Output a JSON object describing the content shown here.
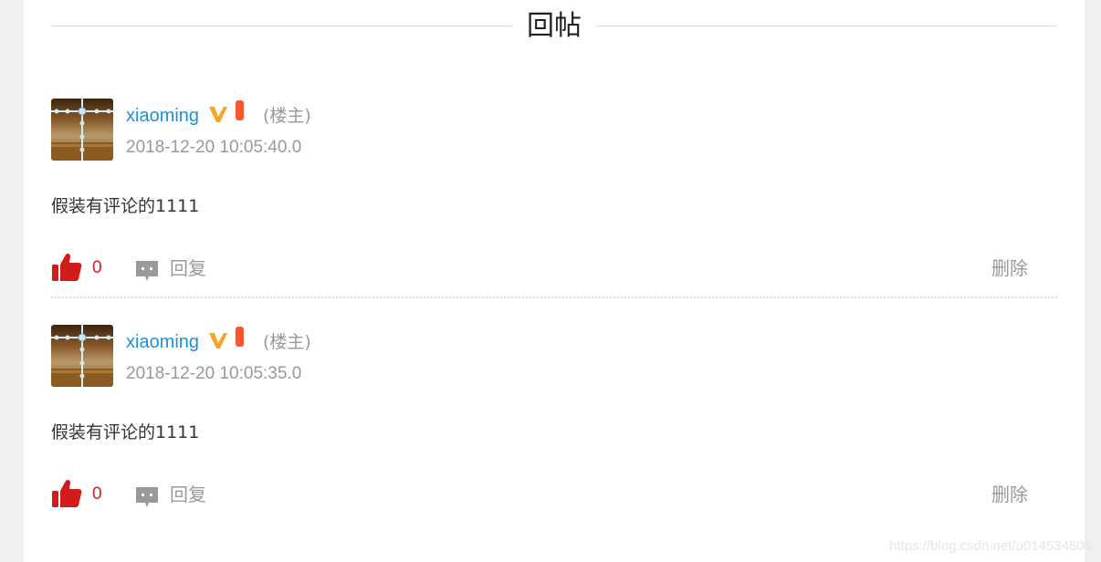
{
  "section": {
    "title": "回帖"
  },
  "comments": [
    {
      "username": "xiaoming",
      "role": "(楼主)",
      "timestamp": "2018-12-20 10:05:40.0",
      "content": "假装有评论的1111",
      "likes": "0",
      "reply_label": "回复",
      "delete_label": "删除"
    },
    {
      "username": "xiaoming",
      "role": "(楼主)",
      "timestamp": "2018-12-20 10:05:35.0",
      "content": "假装有评论的1111",
      "likes": "0",
      "reply_label": "回复",
      "delete_label": "删除"
    }
  ],
  "colors": {
    "username": "#1f8fd4",
    "like": "#d21b1b",
    "vip_badge": "#f5a623",
    "level_badge": "#f5582e",
    "muted_text": "#999999"
  },
  "icons": {
    "like": "thumbs-up-icon",
    "reply": "chat-bubble-icon",
    "vip": "vip-v-icon"
  },
  "watermark": "https://blog.csdn.net/u014534808"
}
